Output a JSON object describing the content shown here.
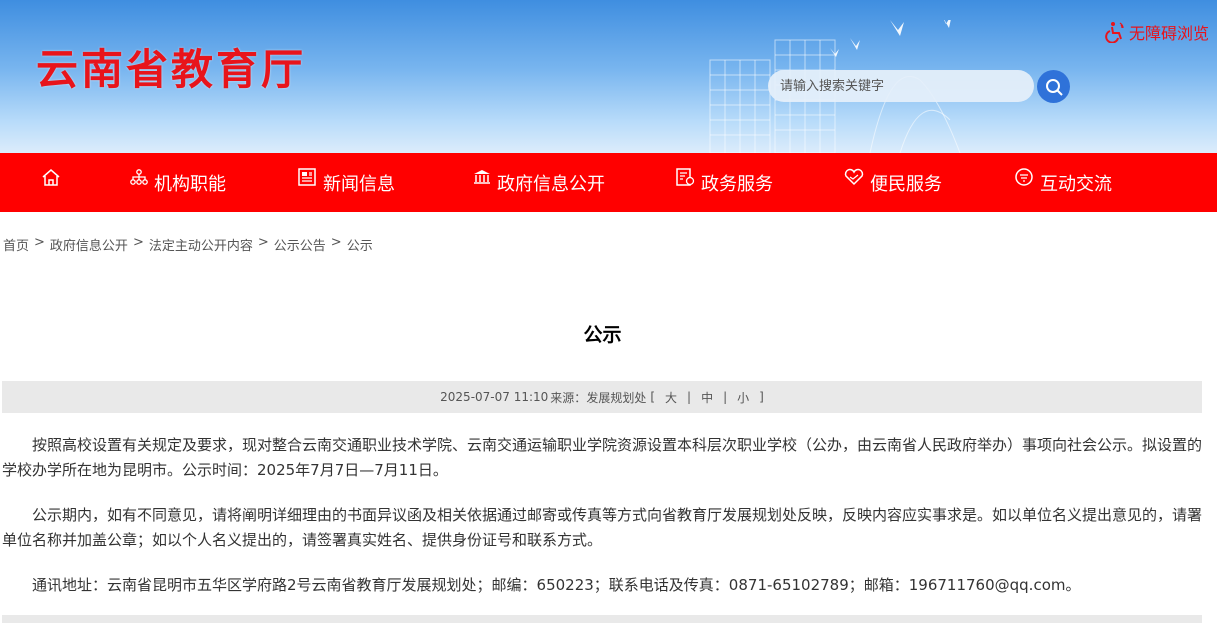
{
  "header": {
    "site_title": "云南省教育厅",
    "accessibility_label": "无障碍浏览",
    "search_placeholder": "请输入搜索关键字"
  },
  "nav": {
    "items": [
      {
        "label": "",
        "icon": "home-icon"
      },
      {
        "label": "机构职能",
        "icon": "org-chart-icon"
      },
      {
        "label": "新闻信息",
        "icon": "newspaper-icon"
      },
      {
        "label": "政府信息公开",
        "icon": "government-building-icon"
      },
      {
        "label": "政务服务",
        "icon": "service-document-icon"
      },
      {
        "label": "便民服务",
        "icon": "heart-hand-icon"
      },
      {
        "label": "互动交流",
        "icon": "chat-icon"
      }
    ]
  },
  "breadcrumb": {
    "items": [
      "首页",
      "政府信息公开",
      "法定主动公开内容",
      "公示公告",
      "公示"
    ],
    "separator": ">"
  },
  "article": {
    "title": "公示",
    "meta": {
      "datetime": "2025-07-07 11:10",
      "source_label": "来源：",
      "source": "发展规划处",
      "font_open": "[",
      "font_close": "]",
      "font_sep": "|",
      "font_large": "大",
      "font_medium": "中",
      "font_small": "小"
    },
    "paragraphs": [
      "按照高校设置有关规定及要求，现对整合云南交通职业技术学院、云南交通运输职业学院资源设置本科层次职业学校（公办，由云南省人民政府举办）事项向社会公示。拟设置的学校办学所在地为昆明市。公示时间：2025年7月7日—7月11日。",
      "公示期内，如有不同意见，请将阐明详细理由的书面异议函及相关依据通过邮寄或传真等方式向省教育厅发展规划处反映，反映内容应实事求是。如以单位名义提出意见的，请署单位名称并加盖公章；如以个人名义提出的，请签署真实姓名、提供身份证号和联系方式。",
      "通讯地址：云南省昆明市五华区学府路2号云南省教育厅发展规划处；邮编：650223；联系电话及传真：0871-65102789；邮箱：196711760@qq.com。"
    ]
  },
  "colors": {
    "brand_red": "#ff0000",
    "title_red": "#e8141b",
    "search_blue": "#2f72d9"
  }
}
